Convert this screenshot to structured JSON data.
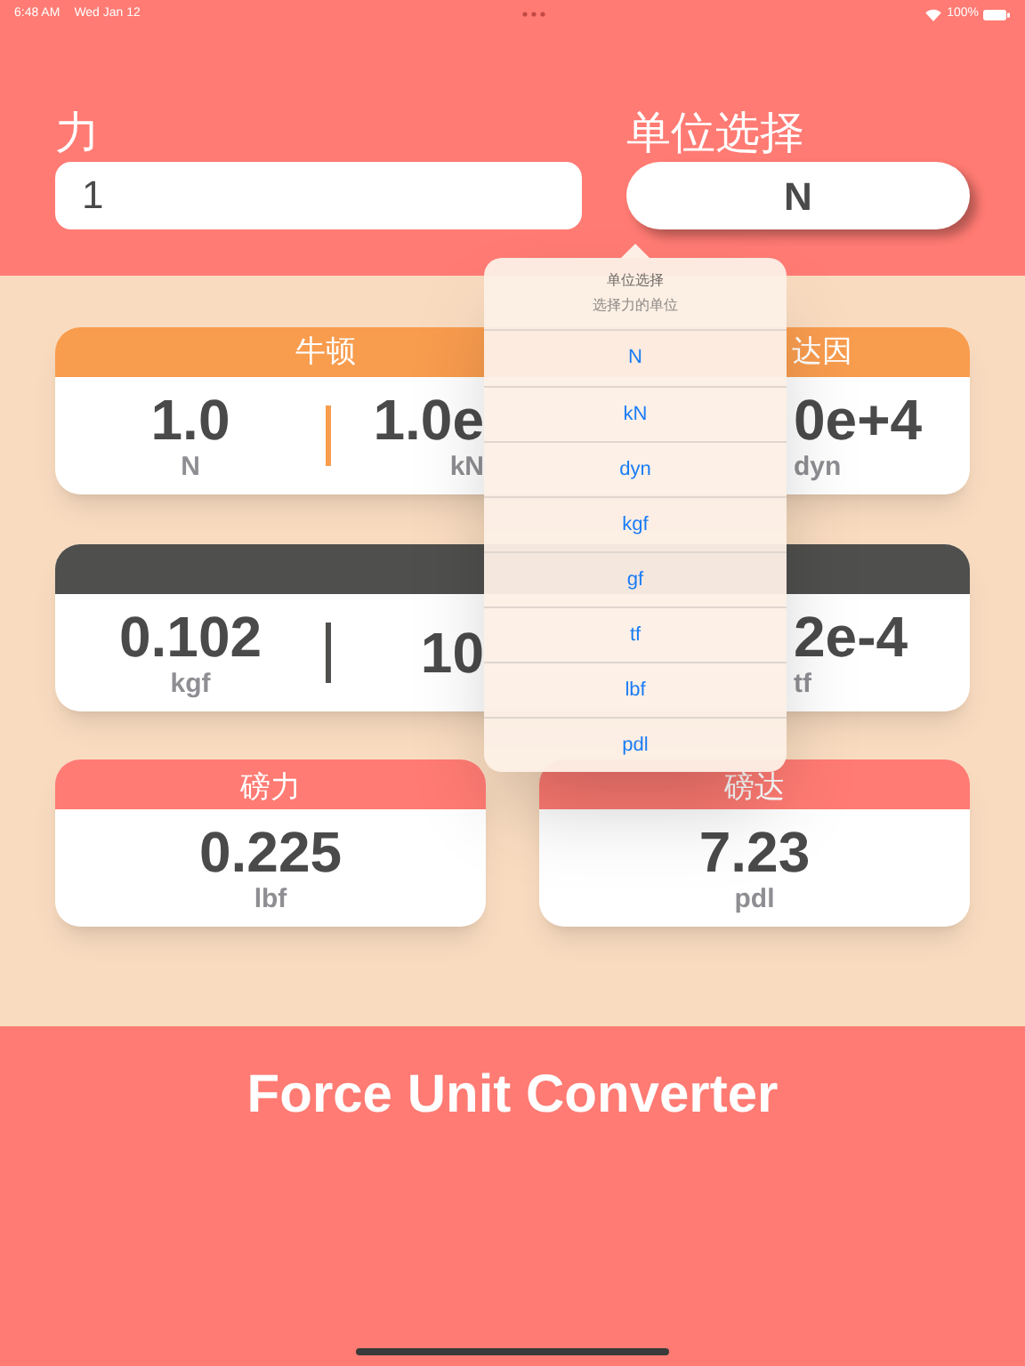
{
  "status_bar": {
    "time": "6:48 AM",
    "date": "Wed Jan 12",
    "battery": "100%"
  },
  "force_field": {
    "label": "力",
    "value": "1"
  },
  "unit_select": {
    "label": "单位选择",
    "value": "N"
  },
  "rows": [
    {
      "kind": "wide",
      "color": "#f89c4e",
      "titles": [
        "牛顿",
        "达因"
      ],
      "values": [
        {
          "value": "1.0",
          "unit": "N"
        },
        {
          "value": "1.0e",
          "unit": "kN"
        },
        {
          "value": "0e+4",
          "unit": "dyn"
        }
      ]
    },
    {
      "kind": "wide",
      "color": "#4f4f4d",
      "titles": [],
      "values": [
        {
          "value": "0.102",
          "unit": "kgf"
        },
        {
          "value": "10"
        },
        {
          "value": "2e-4",
          "unit": "tf"
        }
      ]
    },
    {
      "kind": "pair",
      "cards": [
        {
          "title": "磅力",
          "color": "#ff7b73",
          "value": "0.225",
          "unit": "lbf"
        },
        {
          "title": "磅达",
          "color": "#ff7b73",
          "value": "7.23",
          "unit": "pdl"
        }
      ]
    }
  ],
  "popover": {
    "title": "单位选择",
    "subtitle": "选择力的单位",
    "options": [
      "N",
      "kN",
      "dyn",
      "kgf",
      "gf",
      "tf",
      "lbf",
      "pdl"
    ]
  },
  "footer": {
    "title": "Force Unit Converter"
  }
}
